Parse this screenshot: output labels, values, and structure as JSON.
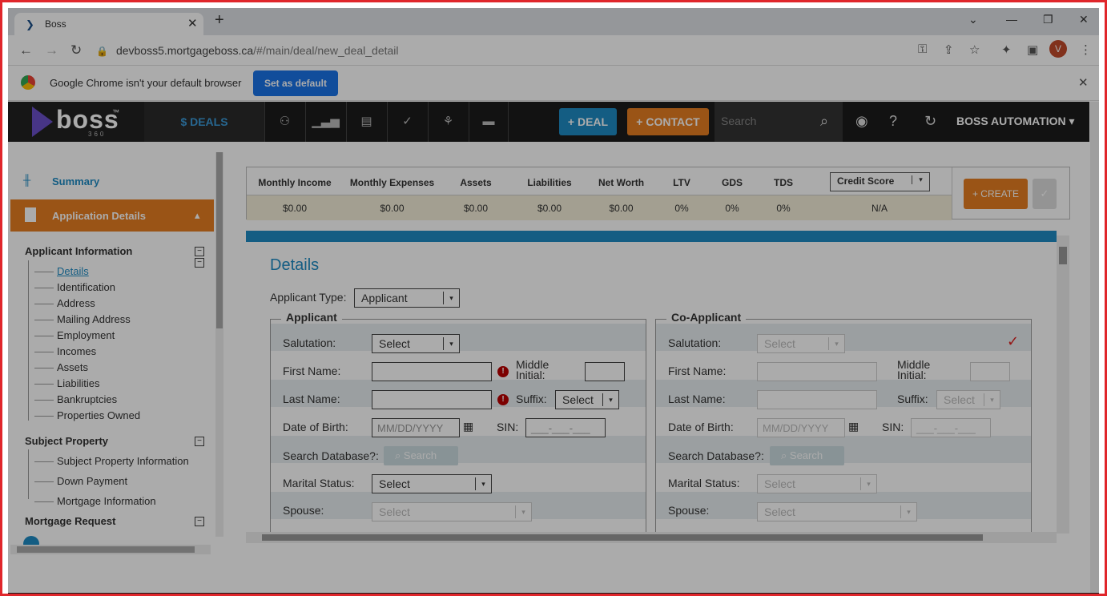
{
  "browser": {
    "tab_title": "Boss",
    "url_host": "devboss5.mortgageboss.ca",
    "url_path": "/#/main/deal/new_deal_detail",
    "avatar_letter": "V",
    "infobar_message": "Google Chrome isn't your default browser",
    "set_default_label": "Set as default"
  },
  "header": {
    "logo_word": "boss",
    "logo_tm": "™",
    "logo_sub": "360",
    "deals_label": "$ DEALS",
    "deal_button": "+ DEAL",
    "contact_button": "+ CONTACT",
    "search_placeholder": "Search",
    "user_label": "BOSS AUTOMATION"
  },
  "sidebar": {
    "summary": "Summary",
    "application_details": "Application Details",
    "sections": [
      {
        "title": "Applicant Information",
        "items": [
          "Details",
          "Identification",
          "Address",
          "Mailing Address",
          "Employment",
          "Incomes",
          "Assets",
          "Liabilities",
          "Bankruptcies",
          "Properties Owned"
        ]
      },
      {
        "title": "Subject Property",
        "items": [
          "Subject Property Information",
          "Down Payment",
          "Mortgage Information"
        ]
      },
      {
        "title": "Mortgage Request",
        "items": []
      }
    ]
  },
  "summary_bar": {
    "headers": [
      "Monthly Income",
      "Monthly Expenses",
      "Assets",
      "Liabilities",
      "Net Worth",
      "LTV",
      "GDS",
      "TDS"
    ],
    "values": [
      "$0.00",
      "$0.00",
      "$0.00",
      "$0.00",
      "$0.00",
      "0%",
      "0%",
      "0%"
    ],
    "credit_score_label": "Credit Score",
    "credit_score_value": "N/A",
    "create_label": "+ CREATE"
  },
  "form": {
    "title": "Details",
    "applicant_type_label": "Applicant Type:",
    "applicant_type_value": "Applicant",
    "applicant": {
      "legend": "Applicant",
      "salutation_label": "Salutation:",
      "salutation_value": "Select",
      "first_name_label": "First Name:",
      "middle_initial_label": "Middle Initial:",
      "last_name_label": "Last Name:",
      "suffix_label": "Suffix:",
      "suffix_value": "Select",
      "dob_label": "Date of Birth:",
      "dob_placeholder": "MM/DD/YYYY",
      "sin_label": "SIN:",
      "sin_placeholder": "___-___-___",
      "search_db_label": "Search Database?:",
      "search_button": "Search",
      "marital_label": "Marital Status:",
      "marital_value": "Select",
      "spouse_label": "Spouse:",
      "spouse_value": "Select"
    },
    "co_applicant": {
      "legend": "Co-Applicant",
      "salutation_label": "Salutation:",
      "salutation_value": "Select",
      "first_name_label": "First Name:",
      "middle_initial_label": "Middle Initial:",
      "last_name_label": "Last Name:",
      "suffix_label": "Suffix:",
      "suffix_value": "Select",
      "dob_label": "Date of Birth:",
      "dob_placeholder": "MM/DD/YYYY",
      "sin_label": "SIN:",
      "sin_placeholder": "___-___-___",
      "search_db_label": "Search Database?:",
      "search_button": "Search",
      "marital_label": "Marital Status:",
      "marital_value": "Select",
      "spouse_label": "Spouse:",
      "spouse_value": "Select"
    }
  },
  "colors": {
    "accent_blue": "#1e8bc3",
    "accent_orange": "#e67e22",
    "frame_red": "#e0262b"
  }
}
